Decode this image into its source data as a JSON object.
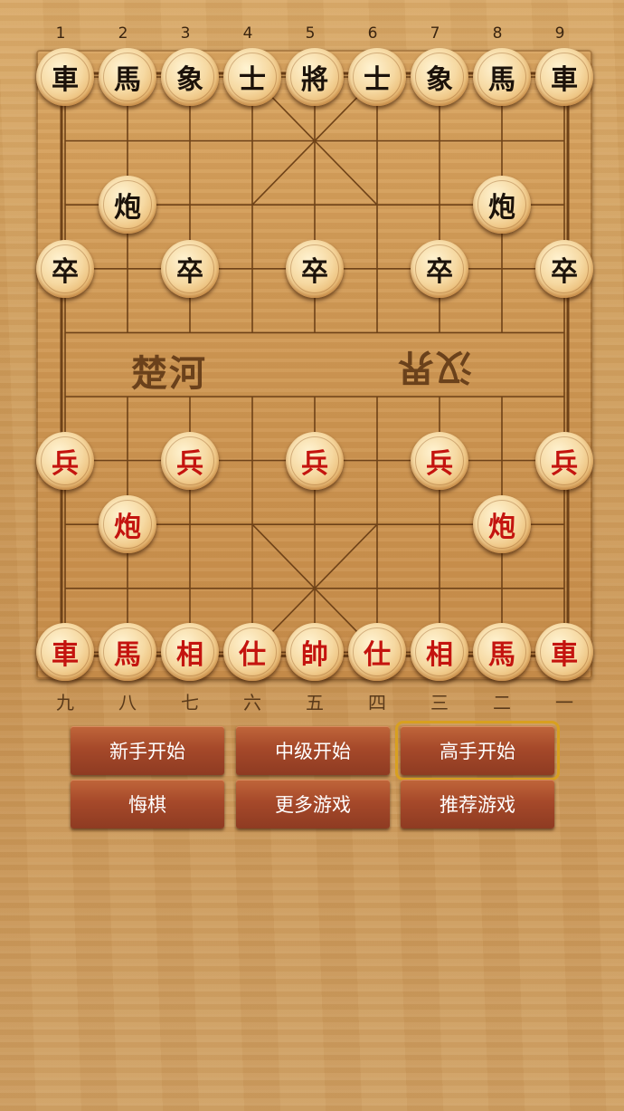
{
  "board": {
    "column_numbers_top": [
      "1",
      "2",
      "3",
      "4",
      "5",
      "6",
      "7",
      "8",
      "9"
    ],
    "column_numbers_bottom": [
      "九",
      "八",
      "七",
      "六",
      "五",
      "四",
      "三",
      "二",
      "一"
    ],
    "river_left": "楚河",
    "river_right": "汉界",
    "pieces": [
      {
        "label": "車",
        "side": "black",
        "col": 0,
        "row": 0
      },
      {
        "label": "馬",
        "side": "black",
        "col": 1,
        "row": 0
      },
      {
        "label": "象",
        "side": "black",
        "col": 2,
        "row": 0
      },
      {
        "label": "士",
        "side": "black",
        "col": 3,
        "row": 0
      },
      {
        "label": "將",
        "side": "black",
        "col": 4,
        "row": 0
      },
      {
        "label": "士",
        "side": "black",
        "col": 5,
        "row": 0
      },
      {
        "label": "象",
        "side": "black",
        "col": 6,
        "row": 0
      },
      {
        "label": "馬",
        "side": "black",
        "col": 7,
        "row": 0
      },
      {
        "label": "車",
        "side": "black",
        "col": 8,
        "row": 0
      },
      {
        "label": "炮",
        "side": "black",
        "col": 1,
        "row": 2
      },
      {
        "label": "炮",
        "side": "black",
        "col": 7,
        "row": 2
      },
      {
        "label": "卒",
        "side": "black",
        "col": 0,
        "row": 3
      },
      {
        "label": "卒",
        "side": "black",
        "col": 2,
        "row": 3
      },
      {
        "label": "卒",
        "side": "black",
        "col": 4,
        "row": 3
      },
      {
        "label": "卒",
        "side": "black",
        "col": 6,
        "row": 3
      },
      {
        "label": "卒",
        "side": "black",
        "col": 8,
        "row": 3
      },
      {
        "label": "兵",
        "side": "red",
        "col": 0,
        "row": 6
      },
      {
        "label": "兵",
        "side": "red",
        "col": 2,
        "row": 6
      },
      {
        "label": "兵",
        "side": "red",
        "col": 4,
        "row": 6
      },
      {
        "label": "兵",
        "side": "red",
        "col": 6,
        "row": 6
      },
      {
        "label": "兵",
        "side": "red",
        "col": 8,
        "row": 6
      },
      {
        "label": "炮",
        "side": "red",
        "col": 1,
        "row": 7
      },
      {
        "label": "炮",
        "side": "red",
        "col": 7,
        "row": 7
      },
      {
        "label": "車",
        "side": "red",
        "col": 0,
        "row": 9
      },
      {
        "label": "馬",
        "side": "red",
        "col": 1,
        "row": 9
      },
      {
        "label": "相",
        "side": "red",
        "col": 2,
        "row": 9
      },
      {
        "label": "仕",
        "side": "red",
        "col": 3,
        "row": 9
      },
      {
        "label": "帥",
        "side": "red",
        "col": 4,
        "row": 9
      },
      {
        "label": "仕",
        "side": "red",
        "col": 5,
        "row": 9
      },
      {
        "label": "相",
        "side": "red",
        "col": 6,
        "row": 9
      },
      {
        "label": "馬",
        "side": "red",
        "col": 7,
        "row": 9
      },
      {
        "label": "車",
        "side": "red",
        "col": 8,
        "row": 9
      }
    ]
  },
  "buttons": {
    "beginner_start": "新手开始",
    "intermediate_start": "中级开始",
    "expert_start": "高手开始",
    "undo": "悔棋",
    "more_games": "更多游戏",
    "recommended_games": "推荐游戏"
  },
  "colors": {
    "red_piece_text": "#c4140f",
    "black_piece_text": "#1b120a",
    "button_bg": "#a6492a",
    "selected_outline": "#d8a020"
  }
}
